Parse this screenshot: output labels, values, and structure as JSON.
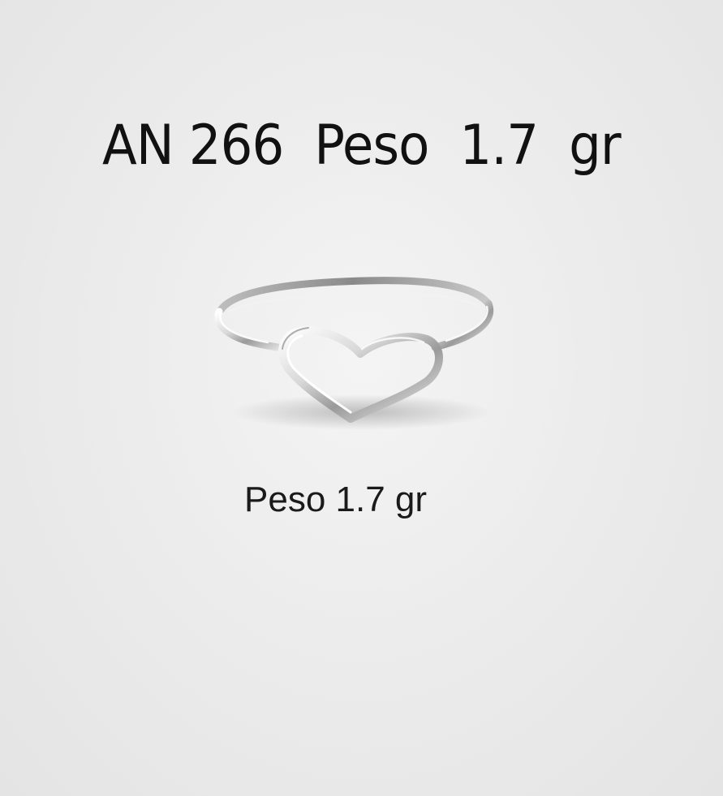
{
  "product": {
    "title": "AN 266  Peso  1.7  gr",
    "caption": "Peso 1.7 gr"
  },
  "photo": {
    "subject_icon": "heart-ring-icon",
    "background_color": "#ececec",
    "metal_color": "#cfcfcf"
  }
}
